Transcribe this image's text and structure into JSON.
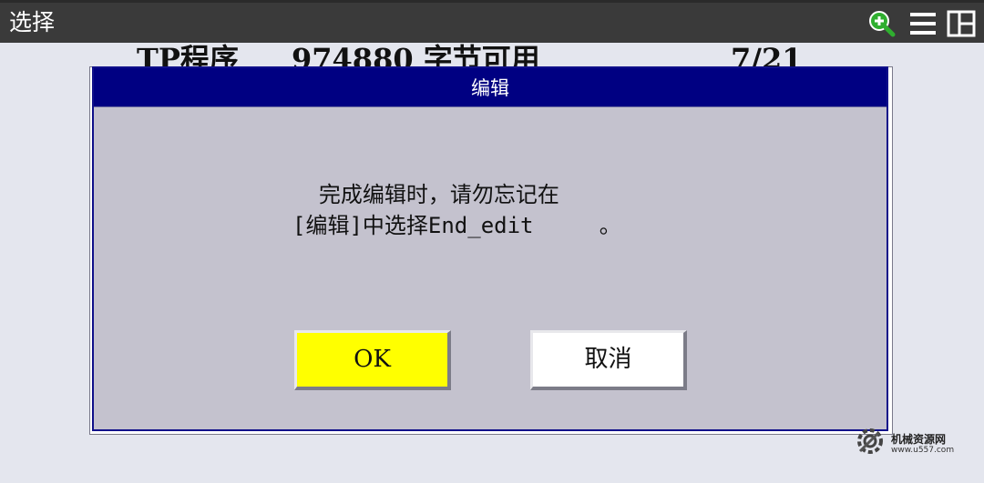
{
  "window": {
    "title": "选择"
  },
  "toolbar": {
    "icons": [
      "zoom-in-icon",
      "menu-icon",
      "layout-icon"
    ],
    "accent": "#2fae2f"
  },
  "background_list": {
    "header_col1": "TP程序",
    "header_col2": "974880 字节可用",
    "header_col3": "7/21"
  },
  "dialog": {
    "title": "编辑",
    "message_line1": "  完成编辑时，请勿忘记在",
    "message_line2": "[编辑]中选择End_edit     。",
    "ok_label": "OK",
    "cancel_label": "取消",
    "colors": {
      "header": "#000082",
      "body": "#c4c2ce",
      "ok": "#ffff00",
      "cancel": "#ffffff"
    }
  },
  "watermark": {
    "name": "机械资源网",
    "url": "www.u557.com"
  }
}
